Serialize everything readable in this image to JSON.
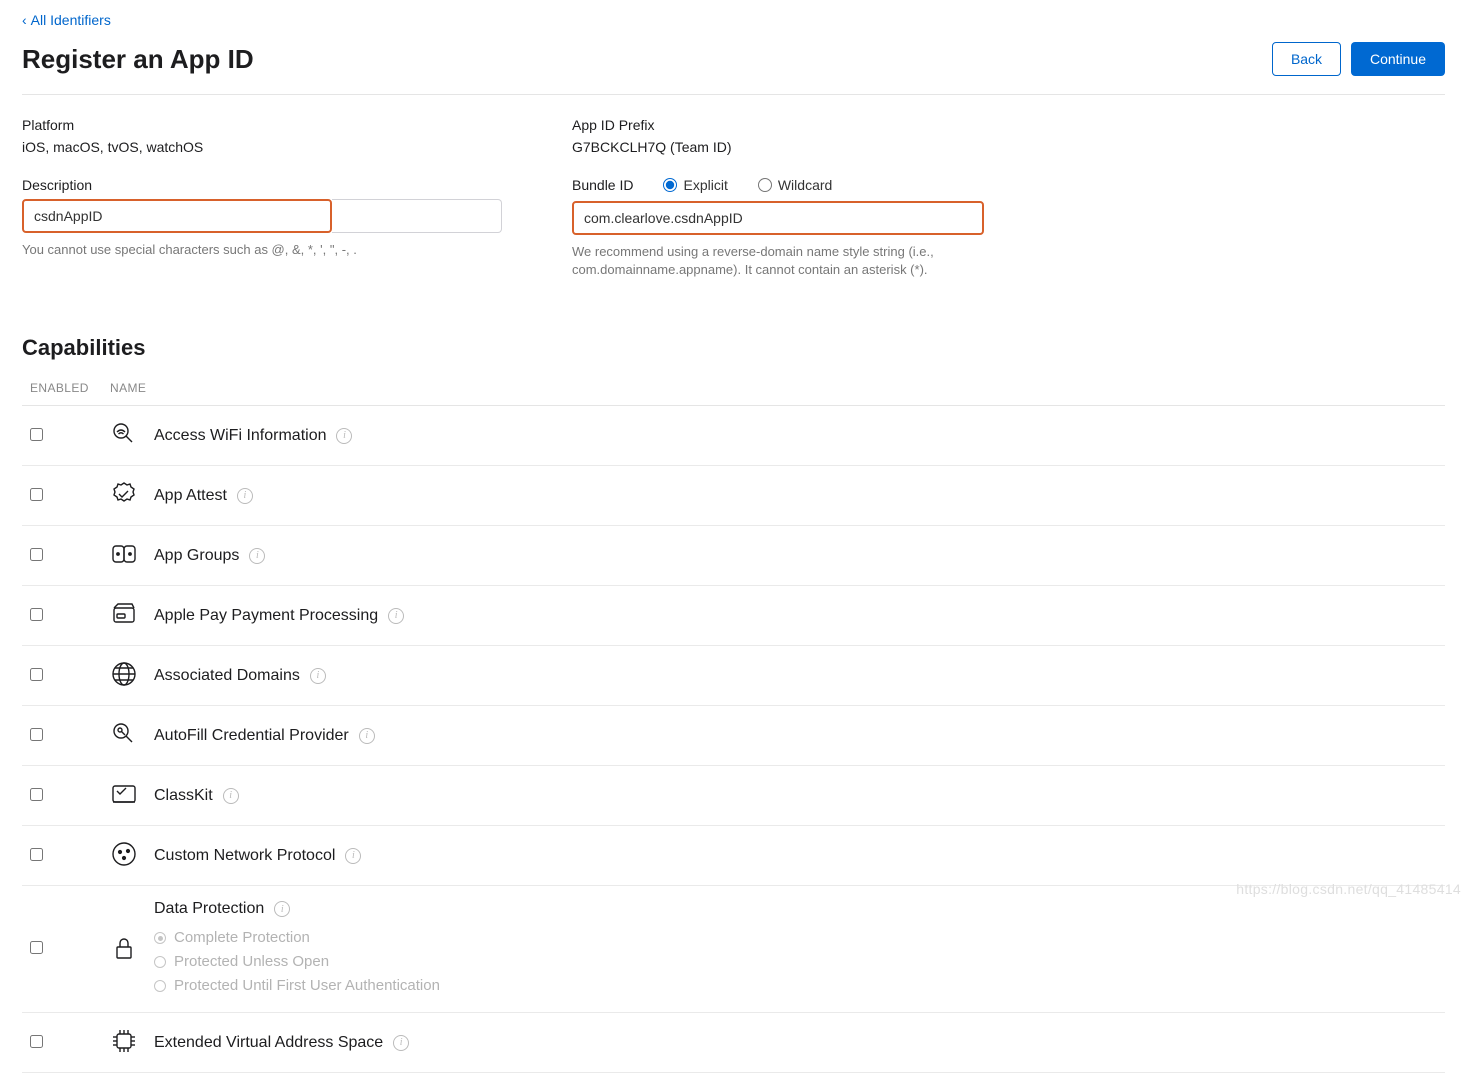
{
  "nav": {
    "back_link": "All Identifiers"
  },
  "header": {
    "title": "Register an App ID",
    "back_button": "Back",
    "continue_button": "Continue"
  },
  "form": {
    "platform": {
      "label": "Platform",
      "value": "iOS, macOS, tvOS, watchOS"
    },
    "prefix": {
      "label": "App ID Prefix",
      "value": "G7BCKCLH7Q (Team ID)"
    },
    "description": {
      "label": "Description",
      "value": "csdnAppID",
      "hint": "You cannot use special characters such as @, &, *, ', \", -, ."
    },
    "bundle": {
      "label": "Bundle ID",
      "option_explicit": "Explicit",
      "option_wildcard": "Wildcard",
      "selected": "explicit",
      "value": "com.clearlove.csdnAppID",
      "hint": "We recommend using a reverse-domain name style string (i.e., com.domainname.appname). It cannot contain an asterisk (*)."
    }
  },
  "capabilities": {
    "title": "Capabilities",
    "columns": {
      "enabled": "ENABLED",
      "name": "NAME"
    },
    "items": [
      {
        "name": "Access WiFi Information",
        "icon": "wifi-search-icon"
      },
      {
        "name": "App Attest",
        "icon": "badge-check-icon"
      },
      {
        "name": "App Groups",
        "icon": "groups-icon"
      },
      {
        "name": "Apple Pay Payment Processing",
        "icon": "wallet-icon"
      },
      {
        "name": "Associated Domains",
        "icon": "globe-icon"
      },
      {
        "name": "AutoFill Credential Provider",
        "icon": "key-search-icon"
      },
      {
        "name": "ClassKit",
        "icon": "chalkboard-icon"
      },
      {
        "name": "Custom Network Protocol",
        "icon": "nodes-icon"
      },
      {
        "name": "Data Protection",
        "icon": "lock-icon",
        "sub_options": [
          {
            "label": "Complete Protection",
            "selected": true
          },
          {
            "label": "Protected Unless Open",
            "selected": false
          },
          {
            "label": "Protected Until First User Authentication",
            "selected": false
          }
        ]
      },
      {
        "name": "Extended Virtual Address Space",
        "icon": "chip-icon"
      }
    ]
  },
  "watermark": "https://blog.csdn.net/qq_41485414"
}
